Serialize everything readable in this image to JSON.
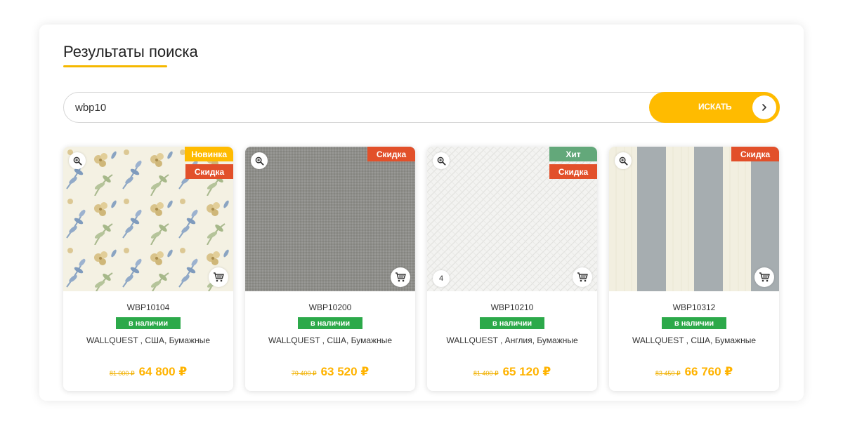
{
  "page": {
    "title": "Результаты поиска"
  },
  "search": {
    "value": "wbp10",
    "button_label": "ИСКАТЬ"
  },
  "colors": {
    "accent": "#ffbb00",
    "sale": "#e2502a",
    "hit": "#63a87a",
    "in_stock": "#2ca94a"
  },
  "products": [
    {
      "sku": "WBP10104",
      "stock": "в наличии",
      "description": "WALLQUEST , США, Бумажные",
      "old_price": "81 000 ₽",
      "price": "64 800 ₽",
      "badges": [
        "Новинка",
        "Скидка"
      ],
      "pattern": "floral"
    },
    {
      "sku": "WBP10200",
      "stock": "в наличии",
      "description": "WALLQUEST , США, Бумажные",
      "old_price": "79 400 ₽",
      "price": "63 520 ₽",
      "badges": [
        "Скидка"
      ],
      "pattern": "gray-linen"
    },
    {
      "sku": "WBP10210",
      "stock": "в наличии",
      "description": "WALLQUEST , Англия, Бумажные",
      "old_price": "81 400 ₽",
      "price": "65 120 ₽",
      "badges": [
        "Хит",
        "Скидка"
      ],
      "image_count": "4",
      "pattern": "white-herringbone"
    },
    {
      "sku": "WBP10312",
      "stock": "в наличии",
      "description": "WALLQUEST , США, Бумажные",
      "old_price": "83 450 ₽",
      "price": "66 760 ₽",
      "badges": [
        "Скидка"
      ],
      "pattern": "stripes"
    }
  ],
  "icons": {
    "zoom": "zoom-in-icon",
    "cart": "cart-icon",
    "arrow": "chevron-right-icon"
  }
}
